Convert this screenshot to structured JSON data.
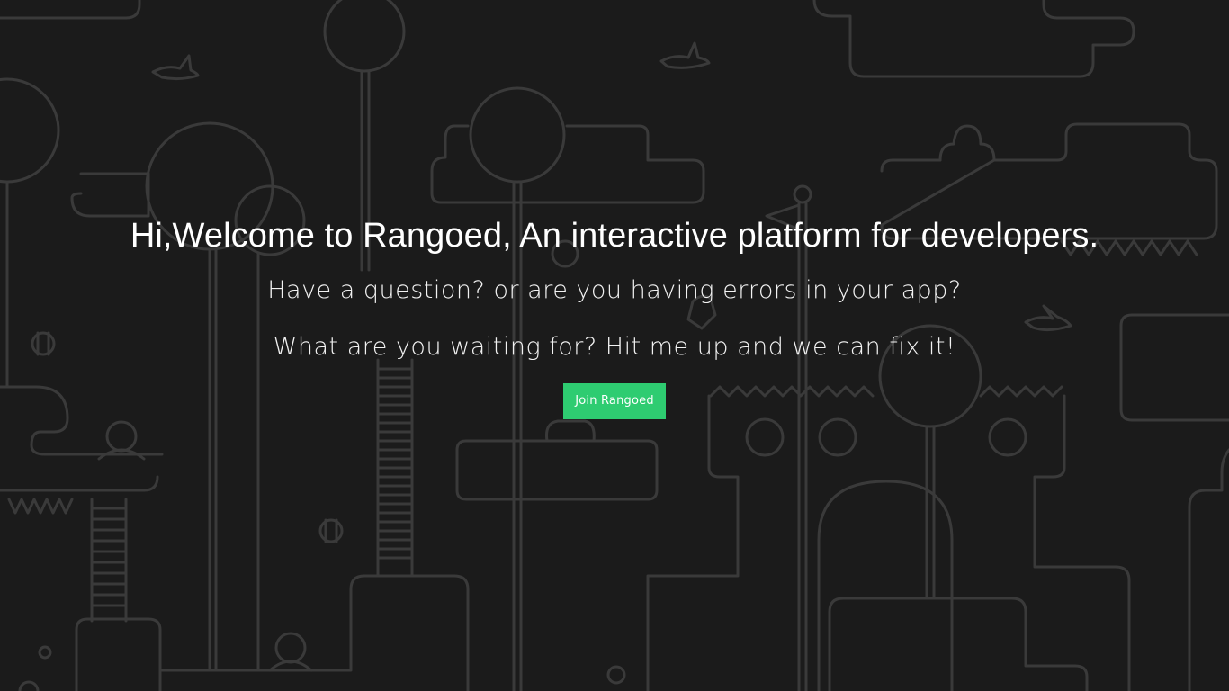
{
  "hero": {
    "title": "Hi,Welcome to Rangoed, An interactive platform for developers.",
    "line1": "Have a question? or are you having errors in your app?",
    "line2": "What are you waiting for? Hit me up and we can fix it!",
    "button_label": "Join Rangoed"
  },
  "colors": {
    "background": "#1b1b1b",
    "line_art": "#3a3a3a",
    "button": "#2ecc71",
    "text": "#ffffff"
  }
}
